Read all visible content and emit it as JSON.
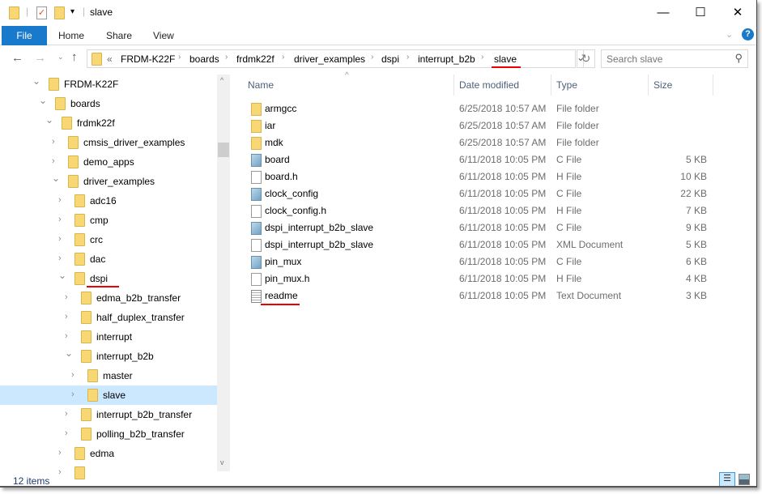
{
  "window": {
    "title": "slave",
    "minimize": "—",
    "maximize": "☐",
    "close": "✕"
  },
  "ribbon": {
    "tabs": [
      "File",
      "Home",
      "Share",
      "View"
    ],
    "help": "?"
  },
  "address": {
    "overflow": "«",
    "crumbs": [
      "FRDM-K22F",
      "boards",
      "frdmk22f",
      "driver_examples",
      "dspi",
      "interrupt_b2b",
      "slave"
    ]
  },
  "search": {
    "placeholder": "Search slave"
  },
  "tree": [
    {
      "label": "FRDM-K22F",
      "level": 0,
      "expanded": true
    },
    {
      "label": "boards",
      "level": 1,
      "expanded": true
    },
    {
      "label": "frdmk22f",
      "level": 2,
      "expanded": true
    },
    {
      "label": "cmsis_driver_examples",
      "level": 3,
      "expanded": false
    },
    {
      "label": "demo_apps",
      "level": 3,
      "expanded": false
    },
    {
      "label": "driver_examples",
      "level": 3,
      "expanded": true
    },
    {
      "label": "adc16",
      "level": 4,
      "expanded": false
    },
    {
      "label": "cmp",
      "level": 4,
      "expanded": false
    },
    {
      "label": "crc",
      "level": 4,
      "expanded": false
    },
    {
      "label": "dac",
      "level": 4,
      "expanded": false
    },
    {
      "label": "dspi",
      "level": 4,
      "expanded": true,
      "highlight": true
    },
    {
      "label": "edma_b2b_transfer",
      "level": 5,
      "expanded": false
    },
    {
      "label": "half_duplex_transfer",
      "level": 5,
      "expanded": false
    },
    {
      "label": "interrupt",
      "level": 5,
      "expanded": false
    },
    {
      "label": "interrupt_b2b",
      "level": 5,
      "expanded": true
    },
    {
      "label": "master",
      "level": 6,
      "expanded": false
    },
    {
      "label": "slave",
      "level": 6,
      "expanded": false,
      "selected": true
    },
    {
      "label": "interrupt_b2b_transfer",
      "level": 5,
      "expanded": false
    },
    {
      "label": "polling_b2b_transfer",
      "level": 5,
      "expanded": false
    },
    {
      "label": "edma",
      "level": 4,
      "expanded": false
    },
    {
      "label": "",
      "level": 4,
      "expanded": false
    }
  ],
  "columns": [
    "Name",
    "Date modified",
    "Type",
    "Size"
  ],
  "files": [
    {
      "name": "armgcc",
      "date": "6/25/2018 10:57 AM",
      "type": "File folder",
      "size": "",
      "icon": "folder"
    },
    {
      "name": "iar",
      "date": "6/25/2018 10:57 AM",
      "type": "File folder",
      "size": "",
      "icon": "folder"
    },
    {
      "name": "mdk",
      "date": "6/25/2018 10:57 AM",
      "type": "File folder",
      "size": "",
      "icon": "folder"
    },
    {
      "name": "board",
      "date": "6/11/2018 10:05 PM",
      "type": "C File",
      "size": "5 KB",
      "icon": "cfile"
    },
    {
      "name": "board.h",
      "date": "6/11/2018 10:05 PM",
      "type": "H File",
      "size": "10 KB",
      "icon": "hfile"
    },
    {
      "name": "clock_config",
      "date": "6/11/2018 10:05 PM",
      "type": "C File",
      "size": "22 KB",
      "icon": "cfile"
    },
    {
      "name": "clock_config.h",
      "date": "6/11/2018 10:05 PM",
      "type": "H File",
      "size": "7 KB",
      "icon": "hfile"
    },
    {
      "name": "dspi_interrupt_b2b_slave",
      "date": "6/11/2018 10:05 PM",
      "type": "C File",
      "size": "9 KB",
      "icon": "cfile"
    },
    {
      "name": "dspi_interrupt_b2b_slave",
      "date": "6/11/2018 10:05 PM",
      "type": "XML Document",
      "size": "5 KB",
      "icon": "hfile"
    },
    {
      "name": "pin_mux",
      "date": "6/11/2018 10:05 PM",
      "type": "C File",
      "size": "6 KB",
      "icon": "cfile"
    },
    {
      "name": "pin_mux.h",
      "date": "6/11/2018 10:05 PM",
      "type": "H File",
      "size": "4 KB",
      "icon": "hfile"
    },
    {
      "name": "readme",
      "date": "6/11/2018 10:05 PM",
      "type": "Text Document",
      "size": "3 KB",
      "icon": "txt",
      "highlight": true
    }
  ],
  "status": {
    "count": "12 items"
  },
  "colors": {
    "accent": "#1979ca",
    "selection": "#cce8ff",
    "annotation": "#e00000"
  }
}
